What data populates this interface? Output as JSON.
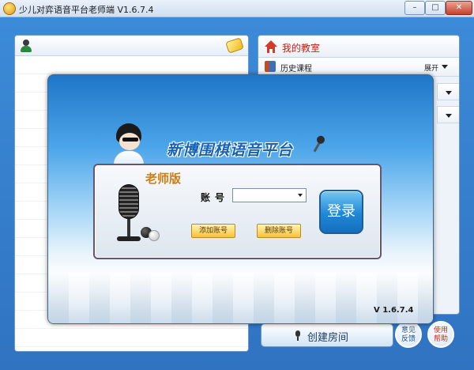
{
  "window": {
    "title": "少儿对弈语音平台老师端 V1.6.7.4",
    "min_glyph": "–",
    "max_glyph": "□",
    "close_glyph": "✕"
  },
  "right_panel": {
    "title": "我的教室",
    "history_label": "历史课程",
    "expand_label": "展开"
  },
  "bottom": {
    "create_room": "创建房间",
    "feedback_line1": "意见",
    "feedback_line2": "反馈",
    "help_line1": "使用",
    "help_line2": "帮助"
  },
  "dialog": {
    "brand": "新博围棋语音平台",
    "edition": "老师版",
    "account_label": "账号",
    "account_value": "",
    "add_account": "添加账号",
    "delete_account": "删除账号",
    "login": "登录",
    "version": "V 1.6.7.4"
  },
  "icons": [
    "app-icon",
    "user-icon",
    "soap-icon",
    "house-icon",
    "book-icon",
    "mic-icon",
    "mascot-icon",
    "go-stones-icon"
  ],
  "colors": {
    "accent_blue": "#2f7ac8",
    "classroom_red": "#c01f12",
    "edition_orange": "#d27c12",
    "button_gold": "#f6c23c",
    "login_blue": "#1f87d6"
  }
}
